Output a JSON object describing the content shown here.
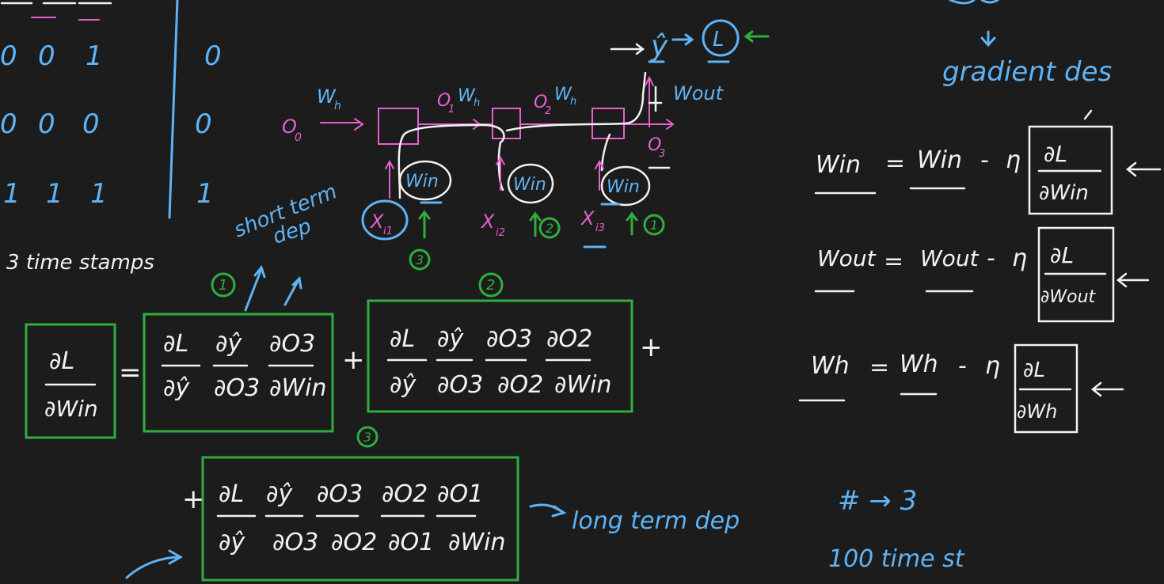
{
  "colors": {
    "background": "#1c1c1c",
    "white": "#f2f2f2",
    "blue": "#5fb3f5",
    "pink": "#e85fd0",
    "green": "#2fae3d"
  },
  "table": {
    "rows": [
      [
        "0",
        "0",
        "1"
      ],
      [
        "0",
        "0",
        "0"
      ],
      [
        "1",
        "1",
        "1"
      ]
    ],
    "targets": [
      "0",
      "0",
      "1"
    ],
    "caption": "3 time stamps"
  },
  "rnn": {
    "o0": "O",
    "o0_sub": "0",
    "wh1": "W",
    "wh1_sub": "h",
    "o1": "O",
    "o1_sub": "1",
    "wh2": "W",
    "wh2_sub": "h",
    "o2": "O",
    "o2_sub": "2",
    "wh3": "W",
    "wh3_sub": "h",
    "o3": "O",
    "o3_sub": "3",
    "win": "Win",
    "x1": "X",
    "x1_sub": "i1",
    "x2": "X",
    "x2_sub": "i2",
    "x3": "X",
    "x3_sub": "i3",
    "yhat": "ŷ",
    "loss": "L",
    "wout": "Wout",
    "circle1": "1",
    "circle2": "2",
    "circle3": "3"
  },
  "short_term": "short term",
  "short_term2": "dep",
  "long_term": "long term dep",
  "derivative": {
    "lhs_num": "∂L",
    "lhs_den": "∂Win",
    "t1_label": "1",
    "t1_num": [
      "∂L",
      "∂ŷ",
      "∂O3"
    ],
    "t1_den": [
      "∂ŷ",
      "∂O3",
      "∂Win"
    ],
    "t2_label": "2",
    "t2_num": [
      "∂L",
      "∂ŷ",
      "∂O3",
      "∂O2"
    ],
    "t2_den": [
      "∂ŷ",
      "∂O3",
      "∂O2",
      "∂Win"
    ],
    "t3_label": "3",
    "t3_num": [
      "∂L",
      "∂ŷ",
      "∂O3",
      "∂O2",
      "∂O1"
    ],
    "t3_den": [
      "∂ŷ",
      "∂O3",
      "∂O2",
      "∂O1",
      "∂Win"
    ],
    "eq": "=",
    "plus": "+"
  },
  "gradient": {
    "title": "gradient des",
    "updates": [
      {
        "w": "Win",
        "eq": "=",
        "w2": "Win",
        "minus": "-",
        "eta": "η",
        "num": "∂L",
        "den": "∂Win"
      },
      {
        "w": "Wout",
        "eq": "=",
        "w2": "Wout",
        "minus": "-",
        "eta": "η",
        "num": "∂L",
        "den": "∂Wout"
      },
      {
        "w": "Wh",
        "eq": "=",
        "w2": "Wh",
        "minus": "-",
        "eta": "η",
        "num": "∂L",
        "den": "∂Wh"
      }
    ]
  },
  "notes": {
    "hash": "# → 3",
    "steps": "100 time st"
  }
}
